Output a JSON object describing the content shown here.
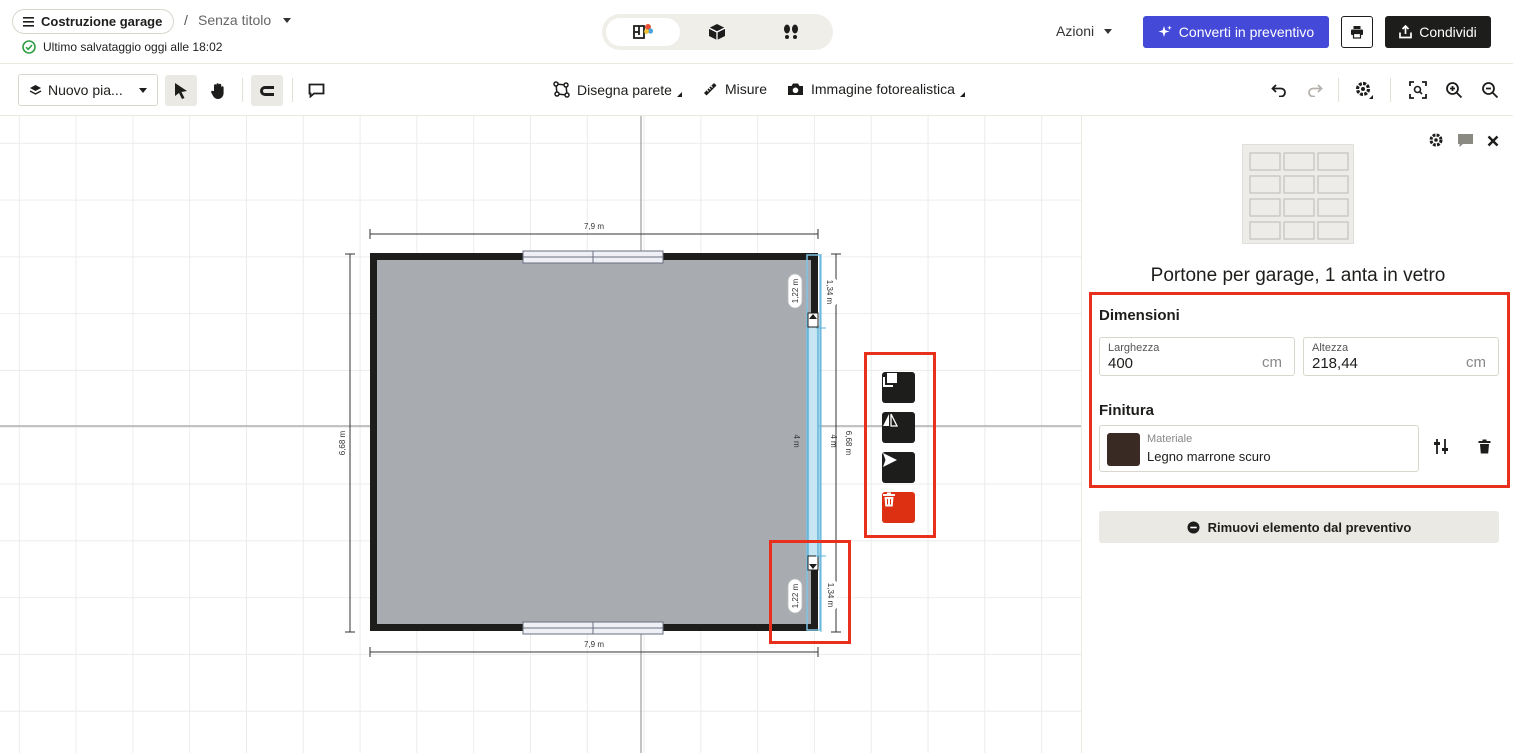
{
  "header": {
    "project_name": "Costruzione garage",
    "separator": "/",
    "doc_title": "Senza titolo",
    "save_status": "Ultimo salvataggio oggi alle 18:02",
    "actions_label": "Azioni",
    "convert_label": "Converti in preventivo",
    "share_label": "Condividi",
    "view_modes": [
      "floorplan-2d-icon",
      "box-3d-icon",
      "footsteps-icon"
    ]
  },
  "toolbar": {
    "floor_label": "Nuovo pia...",
    "draw_wall": "Disegna parete",
    "measures": "Misure",
    "photo": "Immagine fotorealistica"
  },
  "canvas": {
    "width_top": "7,9 m",
    "width_bottom": "7,9 m",
    "height_left": "6,68 m",
    "height_right": "6,68 m",
    "seg_top_inner": "1,22 m",
    "seg_top_outer": "1,34 m",
    "door_inner": "4 m",
    "door_outer": "4 m",
    "seg_bottom_inner": "1,22 m",
    "seg_bottom_outer": "1,34 m"
  },
  "panel": {
    "product_title": "Portone per garage, 1 anta in vetro",
    "dimensions_title": "Dimensioni",
    "width_label": "Larghezza",
    "width_value": "400",
    "width_unit": "cm",
    "height_label": "Altezza",
    "height_value": "218,44",
    "height_unit": "cm",
    "finish_title": "Finitura",
    "material_label": "Materiale",
    "material_value": "Legno marrone scuro",
    "remove_label": "Rimuovi elemento dal preventivo"
  },
  "colors": {
    "accent": "#4449d8",
    "highlight": "#e8301d",
    "danger": "#dd2f12",
    "floor": "#a8abb0",
    "wall": "#1d1d1b",
    "selection": "#7cc3e3"
  }
}
